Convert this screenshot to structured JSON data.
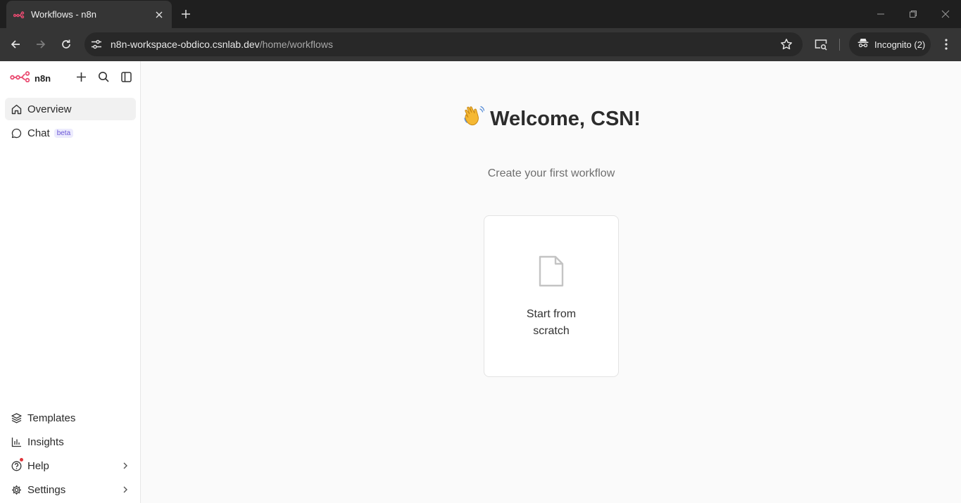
{
  "browser": {
    "tab_title": "Workflows - n8n",
    "url_host": "n8n-workspace-obdico.csnlab.dev",
    "url_path": "/home/workflows",
    "profile_label": "Incognito (2)"
  },
  "sidebar": {
    "brand": "n8n",
    "top_items": [
      {
        "label": "Overview",
        "icon": "home-icon",
        "active": true
      },
      {
        "label": "Chat",
        "icon": "chat-bubble-icon",
        "badge": "beta"
      }
    ],
    "bottom_items": [
      {
        "label": "Templates",
        "icon": "package-icon"
      },
      {
        "label": "Insights",
        "icon": "bar-chart-icon"
      },
      {
        "label": "Help",
        "icon": "help-circle-icon",
        "has_submenu": true
      },
      {
        "label": "Settings",
        "icon": "gear-icon",
        "has_submenu": true
      }
    ]
  },
  "main": {
    "welcome": "Welcome, CSN!",
    "welcome_emoji": "waving-hand",
    "subtitle": "Create your first workflow",
    "card_label": "Start from scratch"
  },
  "colors": {
    "brand": "#ea4b71",
    "beta_text": "#6b57d6",
    "beta_bg": "#ecebfd",
    "notification_dot": "#e0343a"
  }
}
